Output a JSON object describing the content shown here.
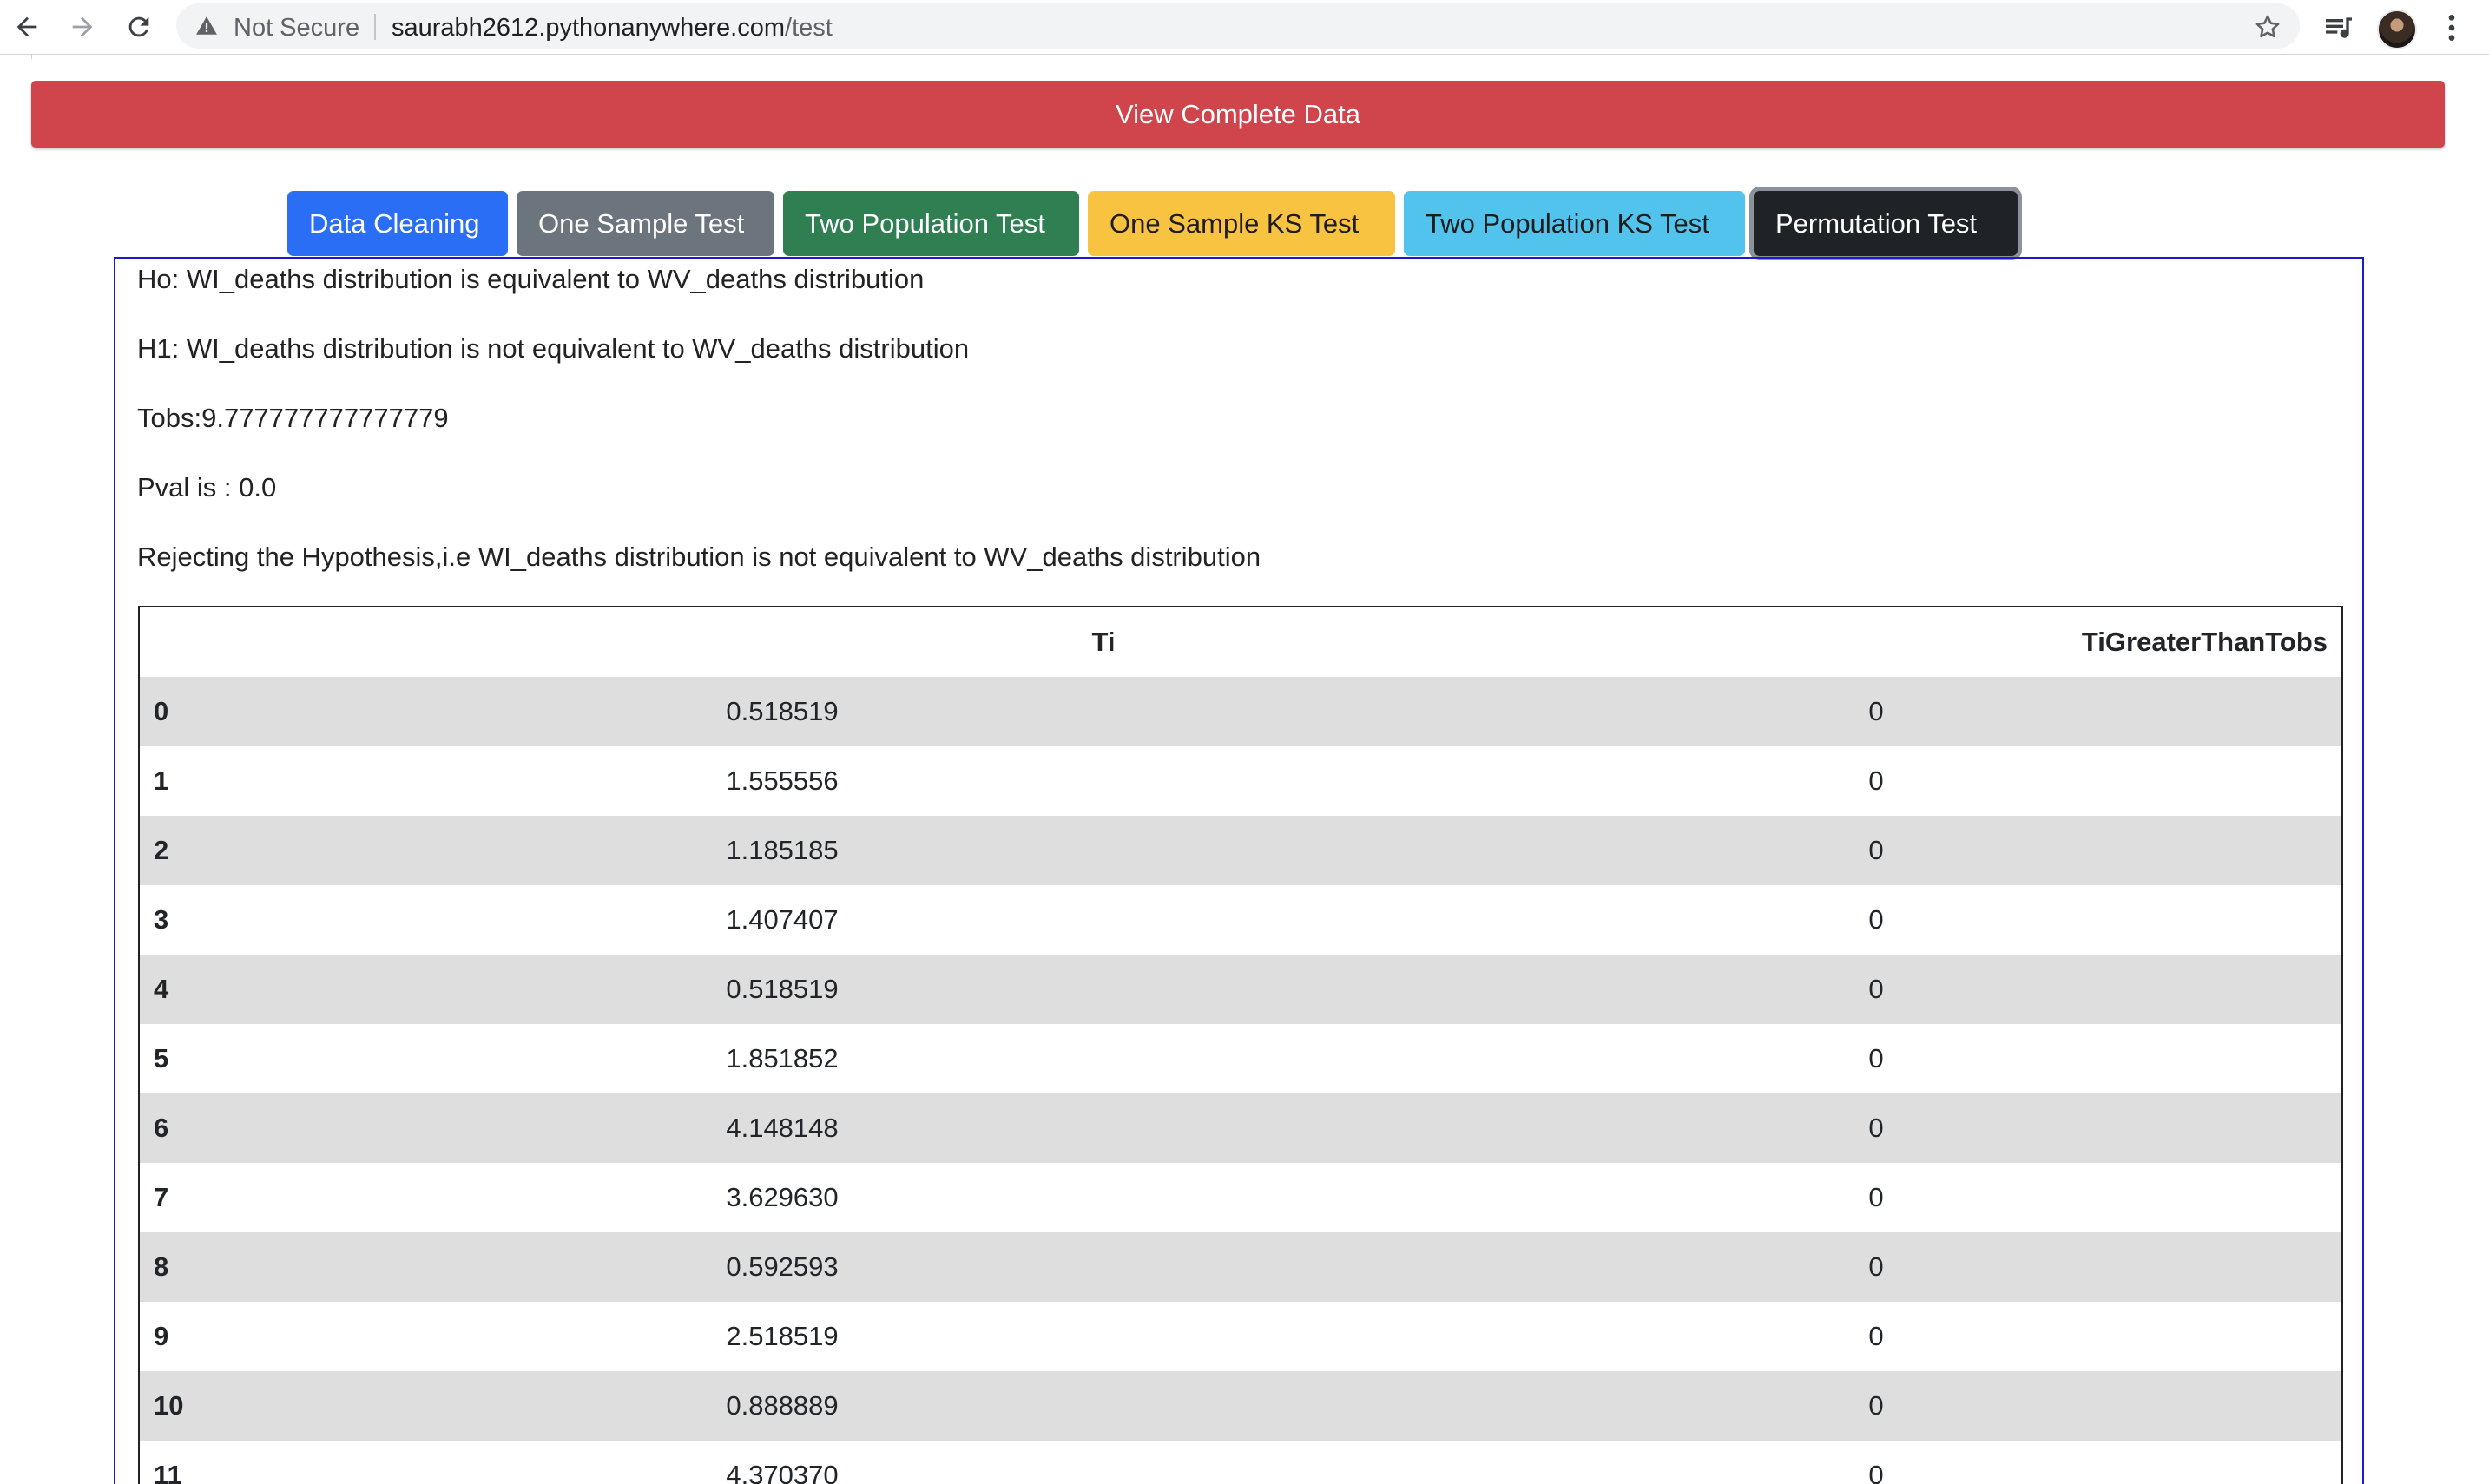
{
  "browser": {
    "security_label": "Not Secure",
    "url_host": "saurabh2612.pythonanywhere.com",
    "url_path": "/test"
  },
  "view_button": "View Complete Data",
  "tabs": [
    {
      "label": "Data Cleaning",
      "color": "#2a6ef5"
    },
    {
      "label": "One Sample Test",
      "color": "#6c757d"
    },
    {
      "label": "Two Population Test",
      "color": "#2f7f52"
    },
    {
      "label": "One Sample KS Test",
      "color": "#f7c341"
    },
    {
      "label": "Two Population KS Test",
      "color": "#52c3ec"
    },
    {
      "label": "Permutation Test",
      "color": "#1f2226",
      "active": true
    }
  ],
  "result": {
    "ho": "Ho: WI_deaths distribution is equivalent to WV_deaths distribution",
    "h1": "H1: WI_deaths distribution is not equivalent to WV_deaths distribution",
    "tobs": "Tobs:9.777777777777779",
    "pval": "Pval is : 0.0",
    "conclusion": "Rejecting the Hypothesis,i.e WI_deaths distribution is not equivalent to WV_deaths distribution"
  },
  "table": {
    "headers": [
      "",
      "Ti",
      "TiGreaterThanTobs"
    ],
    "rows": [
      [
        "0",
        "0.518519",
        "0"
      ],
      [
        "1",
        "1.555556",
        "0"
      ],
      [
        "2",
        "1.185185",
        "0"
      ],
      [
        "3",
        "1.407407",
        "0"
      ],
      [
        "4",
        "0.518519",
        "0"
      ],
      [
        "5",
        "1.851852",
        "0"
      ],
      [
        "6",
        "4.148148",
        "0"
      ],
      [
        "7",
        "3.629630",
        "0"
      ],
      [
        "8",
        "0.592593",
        "0"
      ],
      [
        "9",
        "2.518519",
        "0"
      ],
      [
        "10",
        "0.888889",
        "0"
      ],
      [
        "11",
        "4.370370",
        "0"
      ]
    ]
  },
  "colors": {
    "view_button_bg": "#d0444c",
    "panel_border": "#1a1acb",
    "row_alt_bg": "#dedede"
  }
}
